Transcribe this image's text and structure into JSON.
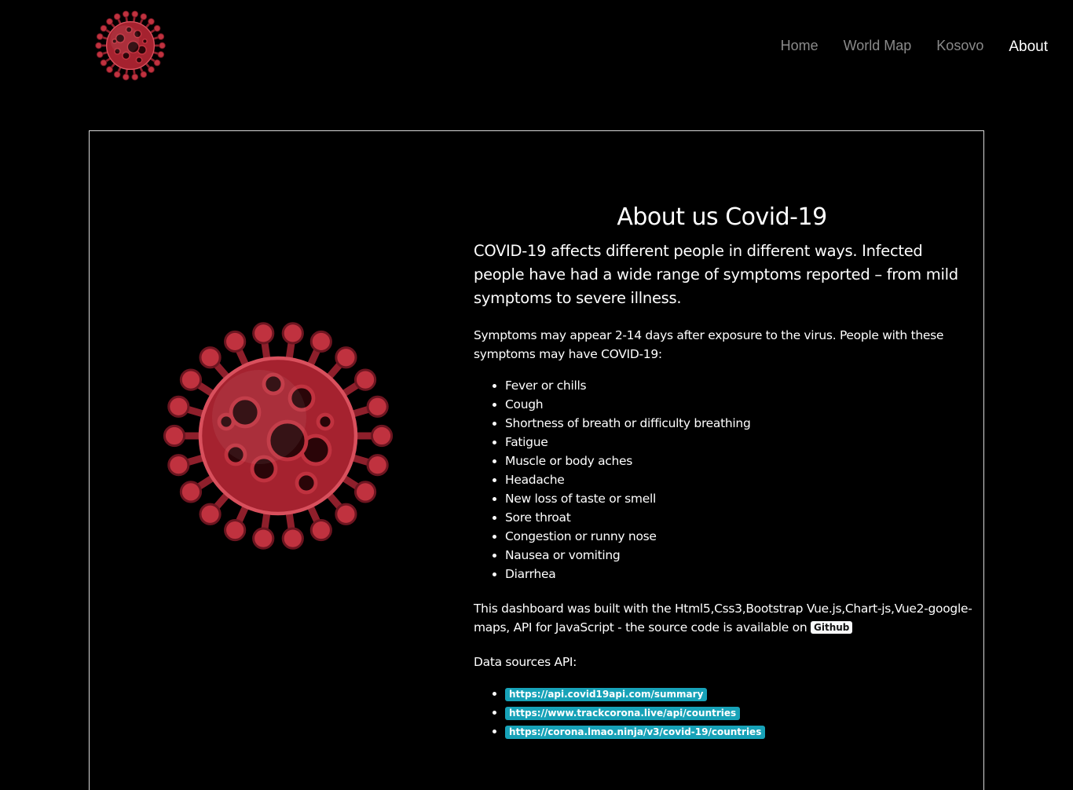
{
  "nav": {
    "logo_icon": "coronavirus-icon",
    "items": [
      "Home",
      "World Map",
      "Kosovo",
      "About"
    ],
    "active": "About"
  },
  "about": {
    "title": "About us Covid-19",
    "lead": "COVID-19 affects different people in different ways. Infected people have had a wide range of symptoms reported – from mild symptoms to severe illness.",
    "symptoms_intro": "Symptoms may appear 2-14 days after exposure to the virus. People with these symptoms may have COVID-19:",
    "symptoms": [
      "Fever or chills",
      "Cough",
      "Shortness of breath or difficulty breathing",
      "Fatigue",
      "Muscle or body aches",
      "Headache",
      "New loss of taste or smell",
      "Sore throat",
      "Congestion or runny nose",
      "Nausea or vomiting",
      "Diarrhea"
    ],
    "built_with": "This dashboard was built with the Html5,Css3,Bootstrap Vue.js,Chart-js,Vue2-google-maps, API for JavaScript - the source code is available on",
    "github_label": "Github",
    "sources_title": "Data sources API:",
    "sources": [
      "https://api.covid19api.com/summary",
      "https://www.trackcorona.live/api/countries",
      "https://corona.lmao.ninja/v3/covid-19/countries"
    ]
  },
  "colors": {
    "background": "#000000",
    "virus_red": "#c0323f",
    "badge_info": "#17a2b8",
    "nav_inactive": "#8a8a8a"
  }
}
